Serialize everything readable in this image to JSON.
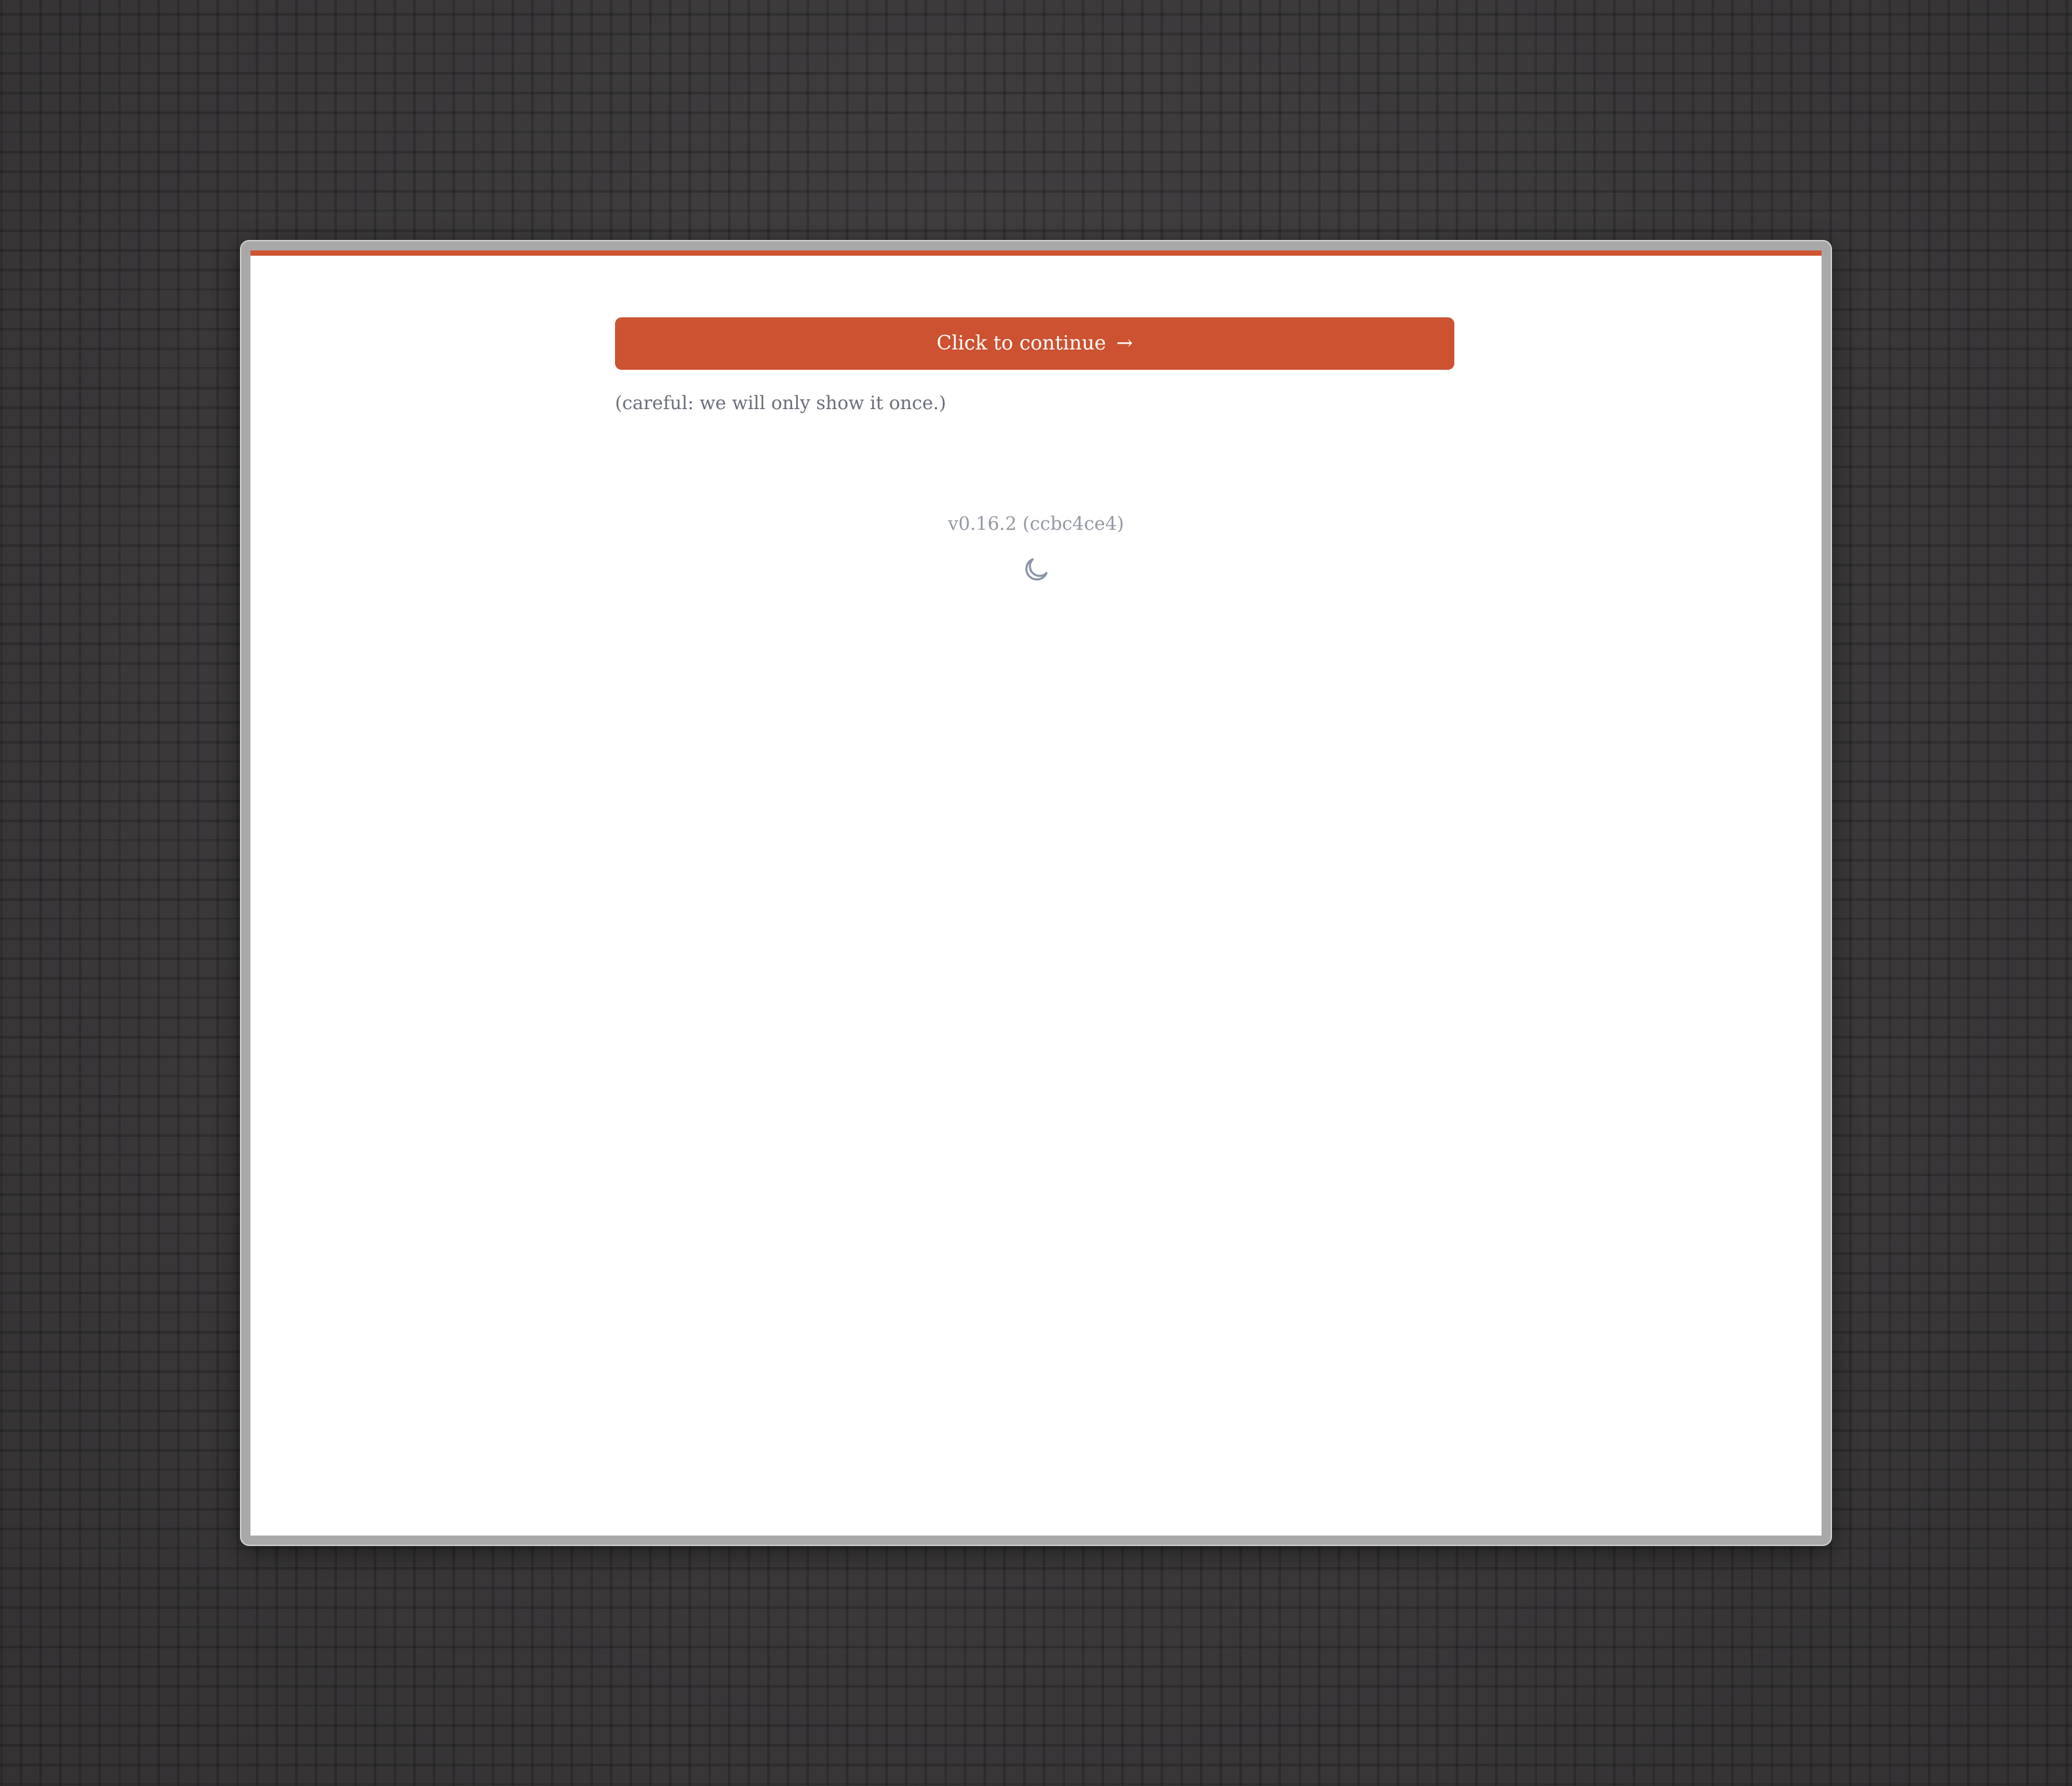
{
  "prompt": {
    "continue_label": "Click to continue",
    "continue_arrow": "→",
    "warning": "(careful: we will only show it once.)"
  },
  "footer": {
    "version": "v0.16.2 (ccbc4ce4)",
    "theme_icon": "moon-icon"
  },
  "colors": {
    "accent": "#cc5231",
    "background": "#3b393a",
    "panel": "#ffffff",
    "muted_text": "#9499a3"
  }
}
